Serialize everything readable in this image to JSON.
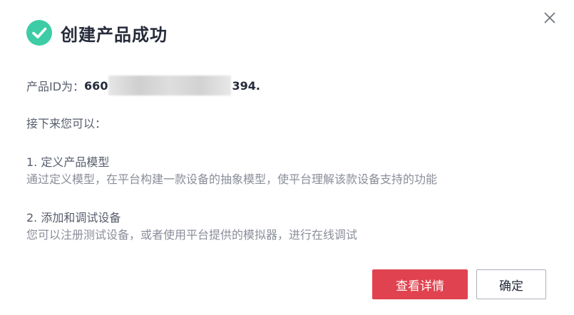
{
  "dialog": {
    "title": "创建产品成功",
    "close_icon": "close-icon",
    "success_icon": "check-circle-icon",
    "accent_color": "#3dcca6"
  },
  "product": {
    "id_label": "产品ID为：",
    "id_prefix": "660",
    "id_suffix": "394."
  },
  "next_steps": {
    "intro": "接下来您可以：",
    "steps": [
      {
        "title": "1. 定义产品模型",
        "desc": "通过定义模型，在平台构建一款设备的抽象模型，使平台理解该款设备支持的功能"
      },
      {
        "title": "2. 添加和调试设备",
        "desc": "您可以注册测试设备，或者使用平台提供的模拟器，进行在线调试"
      }
    ]
  },
  "buttons": {
    "view_details": "查看详情",
    "confirm": "确定"
  }
}
